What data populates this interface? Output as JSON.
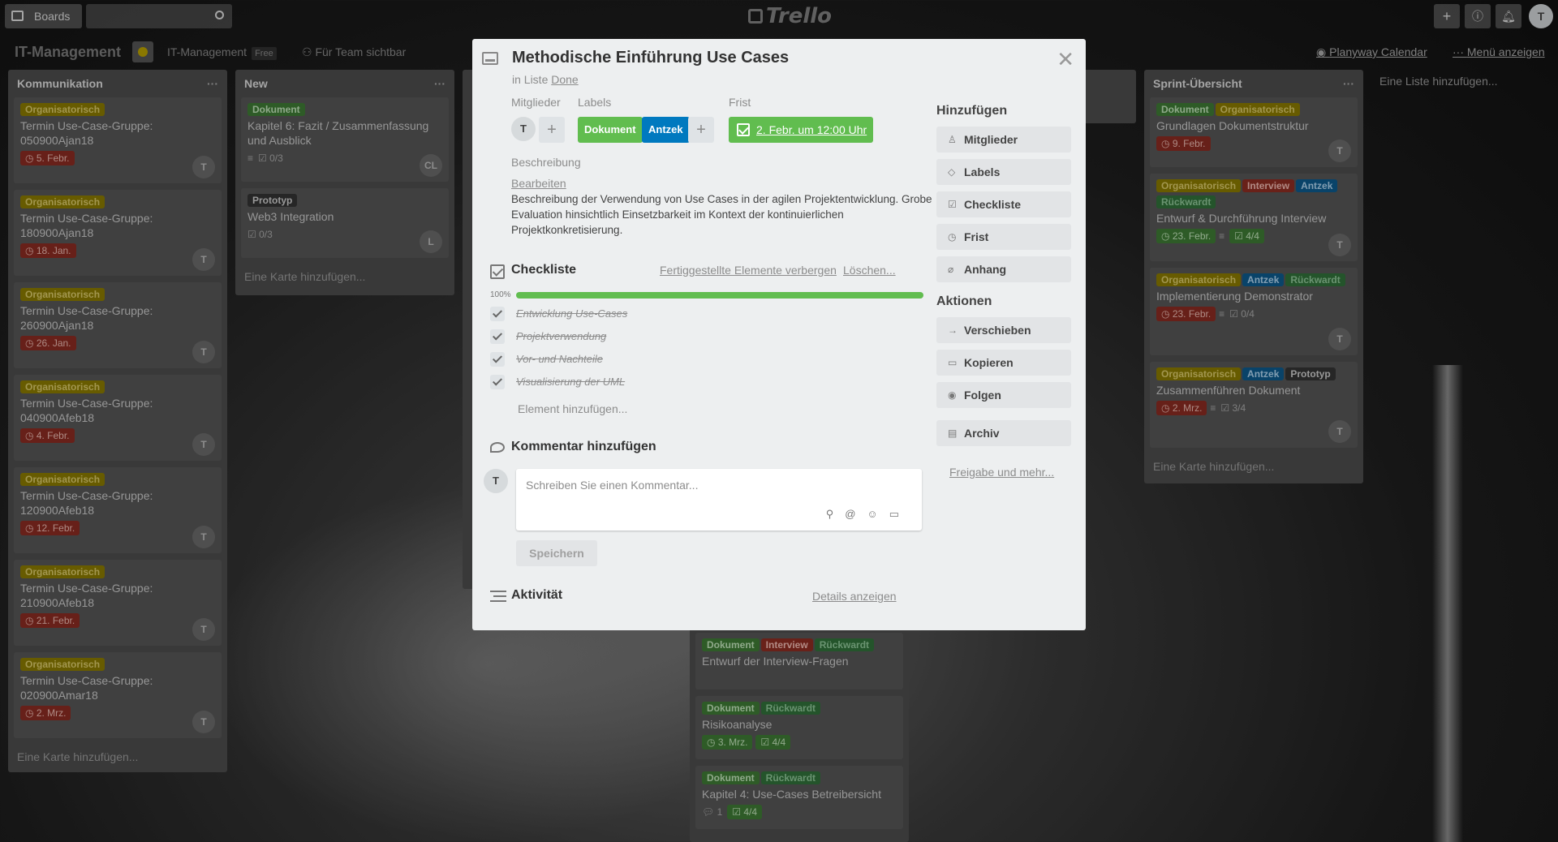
{
  "header": {
    "boards_label": "Boards",
    "logo_text": "Trello",
    "user_initial": "T"
  },
  "board": {
    "title": "IT-Management",
    "org": "IT-Management",
    "plan": "Free",
    "visibility": "Für Team sichtbar",
    "calendar": "Planyway Calendar",
    "menu": "Menü anzeigen",
    "add_list": "Eine Liste hinzufügen..."
  },
  "lists": [
    {
      "title": "Kommunikation",
      "add_card": "Eine Karte hinzufügen...",
      "cards": [
        {
          "label": "Organisatorisch",
          "title": "Termin Use-Case-Gruppe: 050900Ajan18",
          "due": "5. Febr.",
          "member": "T"
        },
        {
          "label": "Organisatorisch",
          "title": "Termin Use-Case-Gruppe: 180900Ajan18",
          "due": "18. Jan.",
          "member": "T"
        },
        {
          "label": "Organisatorisch",
          "title": "Termin Use-Case-Gruppe: 260900Ajan18",
          "due": "26. Jan.",
          "member": "T"
        },
        {
          "label": "Organisatorisch",
          "title": "Termin Use-Case-Gruppe: 040900Afeb18",
          "due": "4. Febr.",
          "member": "T"
        },
        {
          "label": "Organisatorisch",
          "title": "Termin Use-Case-Gruppe: 120900Afeb18",
          "due": "12. Febr.",
          "member": "T"
        },
        {
          "label": "Organisatorisch",
          "title": "Termin Use-Case-Gruppe: 210900Afeb18",
          "due": "21. Febr.",
          "member": "T"
        },
        {
          "label": "Organisatorisch",
          "title": "Termin Use-Case-Gruppe: 020900Amar18",
          "due": "2. Mrz.",
          "member": "T"
        }
      ]
    },
    {
      "title": "New",
      "add_card": "Eine Karte hinzufügen...",
      "cards": [
        {
          "label": "Dokument",
          "title": "Kapitel 6: Fazit / Zusammenfassung und Ausblick",
          "checklist": "0/3",
          "member": "CL"
        },
        {
          "label": "Prototyp",
          "title": "Web3 Integration",
          "checklist": "0/3",
          "member": "L"
        }
      ]
    },
    {
      "title": "Sprint-Übersicht",
      "add_card": "Eine Karte hinzufügen...",
      "cards": [
        {
          "labels": [
            "Dokument",
            "Organisatorisch"
          ],
          "title": "Grundlagen Dokumentstruktur",
          "due": "9. Febr.",
          "member": "T"
        },
        {
          "labels": [
            "Organisatorisch",
            "Interview",
            "Antzek",
            "Rückwardt"
          ],
          "title": "Entwurf & Durchführung Interview",
          "due": "23. Febr.",
          "checklist": "4/4",
          "member": "T"
        },
        {
          "labels": [
            "Organisatorisch",
            "Antzek",
            "Rückwardt"
          ],
          "title": "Implementierung Demonstrator",
          "due": "23. Febr.",
          "checklist": "0/4",
          "member": "T"
        },
        {
          "labels": [
            "Organisatorisch",
            "Antzek",
            "Prototyp"
          ],
          "title": "Zusammenführen Dokument",
          "due": "2. Mrz.",
          "checklist": "3/4",
          "member": "T"
        }
      ]
    },
    {
      "title": "Done",
      "add_card": "Eine Karte hinzufügen...",
      "cards": [
        {
          "labels": [
            "Dokument",
            "Interview",
            "Rückwardt"
          ],
          "title": "Entwurf der Interview-Fragen"
        },
        {
          "labels": [
            "Dokument",
            "Rückwardt"
          ],
          "title": "Risikoanalyse",
          "due": "3. Mrz.",
          "checklist": "4/4"
        },
        {
          "labels": [
            "Dokument",
            "Rückwardt"
          ],
          "title": "Kapitel 4: Use-Cases Betreibersicht",
          "comments": "1",
          "checklist": "4/4"
        }
      ]
    }
  ],
  "modal": {
    "title": "Methodische Einführung Use Cases",
    "in_list_prefix": "in Liste",
    "in_list": "Done",
    "members_label": "Mitglieder",
    "member": "T",
    "labels_label": "Labels",
    "labels": [
      "Dokument",
      "Antzek"
    ],
    "due_label": "Frist",
    "due": "2. Febr. um 12:00 Uhr",
    "desc_label": "Beschreibung",
    "edit": "Bearbeiten",
    "description": "Beschreibung der Verwendung von Use Cases in der agilen Projektentwicklung. Grobe Evaluation hinsichtlich Einsetzbarkeit im Kontext der kontinuierlichen Projektkonkretisierung.",
    "checklist_title": "Checkliste",
    "hide_done": "Fertiggestellte Elemente verbergen",
    "delete": "Löschen...",
    "progress": "100%",
    "progress_value": 100,
    "checklist": [
      "Entwicklung Use-Cases",
      "Projektverwendung",
      "Vor- und Nachteile",
      "Visualisierung der UML"
    ],
    "add_item": "Element hinzufügen...",
    "comment_title": "Kommentar hinzufügen",
    "comment_placeholder": "Schreiben Sie einen Kommentar...",
    "save": "Speichern",
    "activity_title": "Aktivität",
    "details": "Details anzeigen",
    "add_title": "Hinzufügen",
    "add_buttons": [
      "Mitglieder",
      "Labels",
      "Checkliste",
      "Frist",
      "Anhang"
    ],
    "actions_title": "Aktionen",
    "action_buttons": [
      "Verschieben",
      "Kopieren",
      "Folgen",
      "Archiv"
    ],
    "share": "Freigabe und mehr..."
  },
  "colors": {
    "green": "#61bd4f",
    "blue": "#0079bf",
    "label_green": "#61bd4f"
  }
}
